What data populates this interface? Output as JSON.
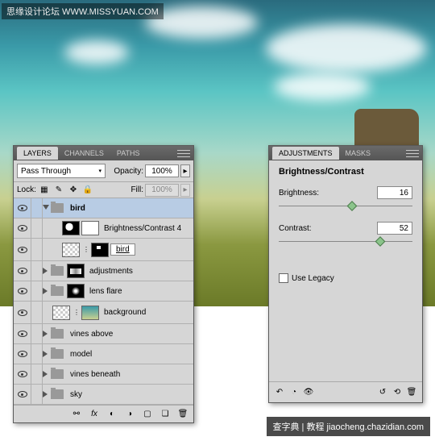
{
  "watermarks": {
    "top": "思缘设计论坛  WWW.MISSYUAN.COM",
    "bottom": "查字典 | 教程 jiaocheng.chazidian.com"
  },
  "layers_panel": {
    "tabs": [
      "LAYERS",
      "CHANNELS",
      "PATHS"
    ],
    "active_tab": 0,
    "blend_mode": "Pass Through",
    "opacity_label": "Opacity:",
    "opacity_value": "100%",
    "lock_label": "Lock:",
    "fill_label": "Fill:",
    "fill_value": "100%",
    "layers": [
      {
        "name": "bird",
        "type": "group",
        "expanded": true,
        "selected": true,
        "indent": 0,
        "bold": true
      },
      {
        "name": "Brightness/Contrast 4",
        "type": "adjustment",
        "indent": 1
      },
      {
        "name": "bird",
        "type": "masked",
        "indent": 1,
        "underline": true
      },
      {
        "name": "adjustments",
        "type": "group-thumb",
        "indent": 0
      },
      {
        "name": "lens flare",
        "type": "group-thumb",
        "indent": 0
      },
      {
        "name": "background",
        "type": "image",
        "indent": 0
      },
      {
        "name": "vines above",
        "type": "group",
        "expanded": false,
        "indent": 0
      },
      {
        "name": "model",
        "type": "group",
        "expanded": false,
        "indent": 0
      },
      {
        "name": "vines beneath",
        "type": "group",
        "expanded": false,
        "indent": 0
      },
      {
        "name": "sky",
        "type": "group",
        "expanded": false,
        "indent": 0
      }
    ]
  },
  "adjust_panel": {
    "tabs": [
      "ADJUSTMENTS",
      "MASKS"
    ],
    "active_tab": 0,
    "title": "Brightness/Contrast",
    "brightness_label": "Brightness:",
    "brightness_value": "16",
    "contrast_label": "Contrast:",
    "contrast_value": "52",
    "legacy_label": "Use Legacy"
  },
  "chart_data": {
    "type": "table",
    "title": "Brightness/Contrast",
    "rows": [
      {
        "param": "Brightness",
        "value": 16,
        "range": [
          -150,
          150
        ]
      },
      {
        "param": "Contrast",
        "value": 52,
        "range": [
          -100,
          100
        ]
      }
    ]
  }
}
